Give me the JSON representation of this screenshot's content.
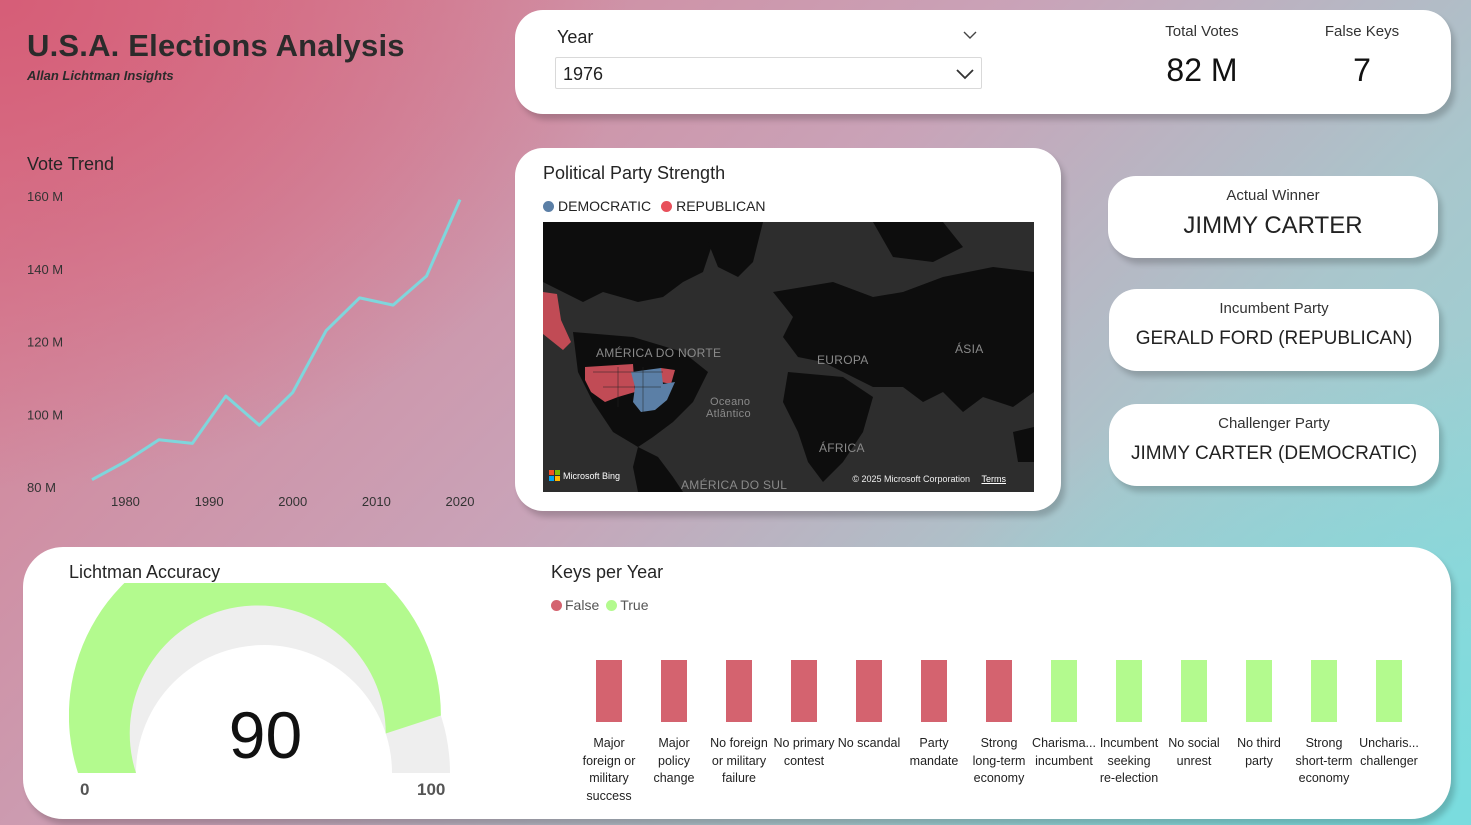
{
  "header": {
    "title": "U.S.A. Elections Analysis",
    "subtitle": "Allan Lichtman Insights"
  },
  "filter": {
    "label": "Year",
    "selected": "1976"
  },
  "kpis": {
    "total_votes_label": "Total Votes",
    "total_votes_value": "82 M",
    "false_keys_label": "False Keys",
    "false_keys_value": "7"
  },
  "vote_trend": {
    "title": "Vote Trend"
  },
  "map": {
    "title": "Political Party Strength",
    "legend": [
      "DEMOCRATIC",
      "REPUBLICAN"
    ],
    "labels": {
      "north_america": "AMÉRICA DO NORTE",
      "europe": "EUROPA",
      "asia": "ÁSIA",
      "ocean": "Oceano",
      "ocean2": "Atlântico",
      "africa": "ÁFRICA",
      "south_america": "AMÉRICA DO SUL"
    },
    "bing": "Microsoft Bing",
    "copyright": "© 2025 Microsoft Corporation",
    "terms": "Terms"
  },
  "info": {
    "winner_label": "Actual Winner",
    "winner_value": "JIMMY CARTER",
    "incumbent_label": "Incumbent Party",
    "incumbent_value": "GERALD FORD (REPUBLICAN)",
    "challenger_label": "Challenger Party",
    "challenger_value": "JIMMY CARTER (DEMOCRATIC)"
  },
  "accuracy": {
    "title": "Lichtman Accuracy",
    "value": "90",
    "min": "0",
    "max": "100"
  },
  "keys": {
    "title": "Keys per Year",
    "legend": [
      "False",
      "True"
    ]
  },
  "colors": {
    "democratic": "#5b7fa6",
    "republican": "#e8505b",
    "false": "#d4636f",
    "true": "#b3fa8e",
    "trend_line": "#7fd6dc",
    "gauge_fill": "#b3fa8e",
    "gauge_empty": "#eeeeee"
  },
  "chart_data": [
    {
      "type": "line",
      "title": "Vote Trend",
      "x": [
        1976,
        1980,
        1984,
        1988,
        1992,
        1996,
        2000,
        2004,
        2008,
        2012,
        2016,
        2020
      ],
      "y": [
        82,
        87,
        93,
        92,
        105,
        97,
        106,
        123,
        132,
        130,
        138,
        159
      ],
      "xticks": [
        "1980",
        "1990",
        "2000",
        "2010",
        "2020"
      ],
      "yticks": [
        "80 M",
        "100 M",
        "120 M",
        "140 M",
        "160 M"
      ],
      "ylim": [
        80,
        160
      ],
      "xlim": [
        1976,
        2020
      ],
      "ylabel": "",
      "xlabel": ""
    },
    {
      "type": "bar",
      "title": "Keys per Year",
      "categories": [
        "Major foreign or military success",
        "Major policy change",
        "No foreign or military failure",
        "No primary contest",
        "No scandal",
        "Party mandate",
        "Strong long-term economy",
        "Charisma... incumbent",
        "Incumbent seeking re-election",
        "No social unrest",
        "No third party",
        "Strong short-term economy",
        "Unchar is... challenger"
      ],
      "category_labels": [
        [
          "Major",
          "foreign or",
          "military",
          "success"
        ],
        [
          "Major",
          "policy",
          "change"
        ],
        [
          "No foreign",
          "or military",
          "failure"
        ],
        [
          "No primary",
          "contest"
        ],
        [
          "No scandal"
        ],
        [
          "Party",
          "mandate"
        ],
        [
          "Strong",
          "long-term",
          "economy"
        ],
        [
          "Charisma...",
          "incumbent"
        ],
        [
          "Incumbent",
          "seeking",
          "re-election"
        ],
        [
          "No social",
          "unrest"
        ],
        [
          "No third",
          "party"
        ],
        [
          "Strong",
          "short-term",
          "economy"
        ],
        [
          "Uncharis...",
          "challenger"
        ]
      ],
      "values": [
        1,
        1,
        1,
        1,
        1,
        1,
        1,
        1,
        1,
        1,
        1,
        1,
        1
      ],
      "series_flags": [
        "False",
        "False",
        "False",
        "False",
        "False",
        "False",
        "False",
        "True",
        "True",
        "True",
        "True",
        "True",
        "True"
      ],
      "legend": [
        "False",
        "True"
      ]
    },
    {
      "type": "gauge",
      "title": "Lichtman Accuracy",
      "value": 90,
      "min": 0,
      "max": 100
    }
  ]
}
